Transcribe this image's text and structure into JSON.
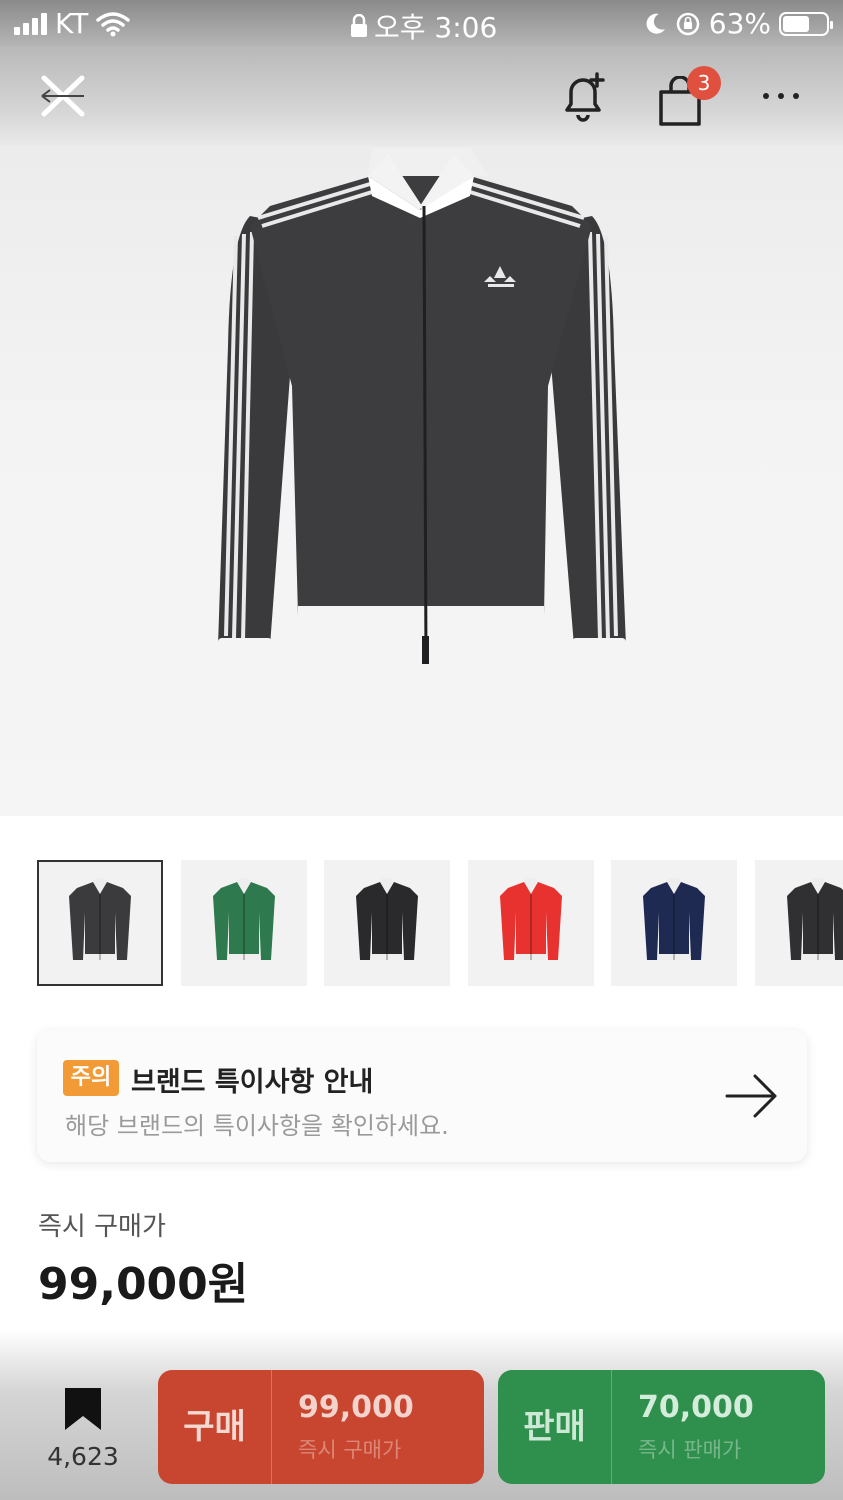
{
  "status_bar": {
    "carrier": "KT",
    "time": "오후 3:06",
    "battery_percent": "63%",
    "battery_level": 0.63
  },
  "nav": {
    "cart_badge": "3"
  },
  "product": {
    "thumbnail_colors": [
      "#3b3a3d",
      "#2e7a4e",
      "#2a2a2c",
      "#e8322f",
      "#1f2a52",
      "#303033"
    ]
  },
  "notice": {
    "tag": "주의",
    "title": "브랜드 특이사항 안내",
    "subtitle": "해당 브랜드의 특이사항을 확인하세요."
  },
  "price": {
    "label": "즉시 구매가",
    "value": "99,000원"
  },
  "bottom_bar": {
    "bookmark_count": "4,623",
    "buy": {
      "label": "구매",
      "price": "99,000",
      "sub": "즉시 구매가"
    },
    "sell": {
      "label": "판매",
      "price": "70,000",
      "sub": "즉시 판매가"
    }
  },
  "colors": {
    "buy": "#c8452f",
    "sell": "#2f8f4d",
    "notice_tag": "#f29a35",
    "badge": "#e0503e"
  }
}
